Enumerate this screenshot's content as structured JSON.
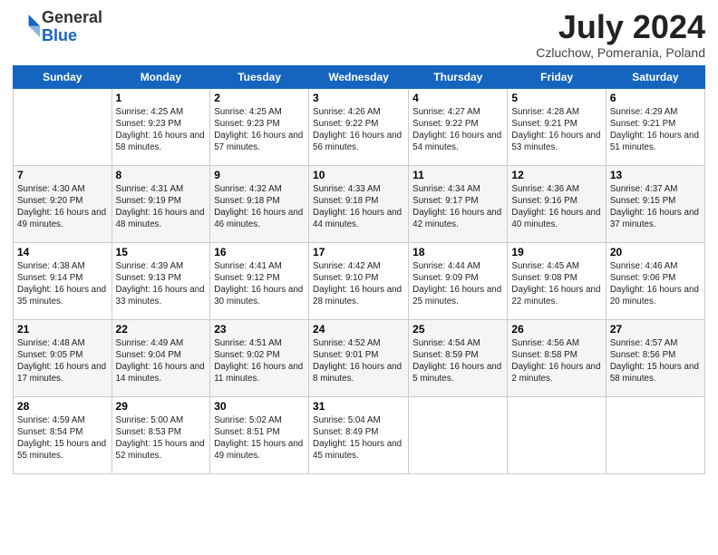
{
  "header": {
    "logo_general": "General",
    "logo_blue": "Blue",
    "month_title": "July 2024",
    "location": "Czluchow, Pomerania, Poland"
  },
  "days_of_week": [
    "Sunday",
    "Monday",
    "Tuesday",
    "Wednesday",
    "Thursday",
    "Friday",
    "Saturday"
  ],
  "weeks": [
    [
      {
        "num": "",
        "info": ""
      },
      {
        "num": "1",
        "info": "Sunrise: 4:25 AM\nSunset: 9:23 PM\nDaylight: 16 hours\nand 58 minutes."
      },
      {
        "num": "2",
        "info": "Sunrise: 4:25 AM\nSunset: 9:23 PM\nDaylight: 16 hours\nand 57 minutes."
      },
      {
        "num": "3",
        "info": "Sunrise: 4:26 AM\nSunset: 9:22 PM\nDaylight: 16 hours\nand 56 minutes."
      },
      {
        "num": "4",
        "info": "Sunrise: 4:27 AM\nSunset: 9:22 PM\nDaylight: 16 hours\nand 54 minutes."
      },
      {
        "num": "5",
        "info": "Sunrise: 4:28 AM\nSunset: 9:21 PM\nDaylight: 16 hours\nand 53 minutes."
      },
      {
        "num": "6",
        "info": "Sunrise: 4:29 AM\nSunset: 9:21 PM\nDaylight: 16 hours\nand 51 minutes."
      }
    ],
    [
      {
        "num": "7",
        "info": "Sunrise: 4:30 AM\nSunset: 9:20 PM\nDaylight: 16 hours\nand 49 minutes."
      },
      {
        "num": "8",
        "info": "Sunrise: 4:31 AM\nSunset: 9:19 PM\nDaylight: 16 hours\nand 48 minutes."
      },
      {
        "num": "9",
        "info": "Sunrise: 4:32 AM\nSunset: 9:18 PM\nDaylight: 16 hours\nand 46 minutes."
      },
      {
        "num": "10",
        "info": "Sunrise: 4:33 AM\nSunset: 9:18 PM\nDaylight: 16 hours\nand 44 minutes."
      },
      {
        "num": "11",
        "info": "Sunrise: 4:34 AM\nSunset: 9:17 PM\nDaylight: 16 hours\nand 42 minutes."
      },
      {
        "num": "12",
        "info": "Sunrise: 4:36 AM\nSunset: 9:16 PM\nDaylight: 16 hours\nand 40 minutes."
      },
      {
        "num": "13",
        "info": "Sunrise: 4:37 AM\nSunset: 9:15 PM\nDaylight: 16 hours\nand 37 minutes."
      }
    ],
    [
      {
        "num": "14",
        "info": "Sunrise: 4:38 AM\nSunset: 9:14 PM\nDaylight: 16 hours\nand 35 minutes."
      },
      {
        "num": "15",
        "info": "Sunrise: 4:39 AM\nSunset: 9:13 PM\nDaylight: 16 hours\nand 33 minutes."
      },
      {
        "num": "16",
        "info": "Sunrise: 4:41 AM\nSunset: 9:12 PM\nDaylight: 16 hours\nand 30 minutes."
      },
      {
        "num": "17",
        "info": "Sunrise: 4:42 AM\nSunset: 9:10 PM\nDaylight: 16 hours\nand 28 minutes."
      },
      {
        "num": "18",
        "info": "Sunrise: 4:44 AM\nSunset: 9:09 PM\nDaylight: 16 hours\nand 25 minutes."
      },
      {
        "num": "19",
        "info": "Sunrise: 4:45 AM\nSunset: 9:08 PM\nDaylight: 16 hours\nand 22 minutes."
      },
      {
        "num": "20",
        "info": "Sunrise: 4:46 AM\nSunset: 9:06 PM\nDaylight: 16 hours\nand 20 minutes."
      }
    ],
    [
      {
        "num": "21",
        "info": "Sunrise: 4:48 AM\nSunset: 9:05 PM\nDaylight: 16 hours\nand 17 minutes."
      },
      {
        "num": "22",
        "info": "Sunrise: 4:49 AM\nSunset: 9:04 PM\nDaylight: 16 hours\nand 14 minutes."
      },
      {
        "num": "23",
        "info": "Sunrise: 4:51 AM\nSunset: 9:02 PM\nDaylight: 16 hours\nand 11 minutes."
      },
      {
        "num": "24",
        "info": "Sunrise: 4:52 AM\nSunset: 9:01 PM\nDaylight: 16 hours\nand 8 minutes."
      },
      {
        "num": "25",
        "info": "Sunrise: 4:54 AM\nSunset: 8:59 PM\nDaylight: 16 hours\nand 5 minutes."
      },
      {
        "num": "26",
        "info": "Sunrise: 4:56 AM\nSunset: 8:58 PM\nDaylight: 16 hours\nand 2 minutes."
      },
      {
        "num": "27",
        "info": "Sunrise: 4:57 AM\nSunset: 8:56 PM\nDaylight: 15 hours\nand 58 minutes."
      }
    ],
    [
      {
        "num": "28",
        "info": "Sunrise: 4:59 AM\nSunset: 8:54 PM\nDaylight: 15 hours\nand 55 minutes."
      },
      {
        "num": "29",
        "info": "Sunrise: 5:00 AM\nSunset: 8:53 PM\nDaylight: 15 hours\nand 52 minutes."
      },
      {
        "num": "30",
        "info": "Sunrise: 5:02 AM\nSunset: 8:51 PM\nDaylight: 15 hours\nand 49 minutes."
      },
      {
        "num": "31",
        "info": "Sunrise: 5:04 AM\nSunset: 8:49 PM\nDaylight: 15 hours\nand 45 minutes."
      },
      {
        "num": "",
        "info": ""
      },
      {
        "num": "",
        "info": ""
      },
      {
        "num": "",
        "info": ""
      }
    ]
  ]
}
